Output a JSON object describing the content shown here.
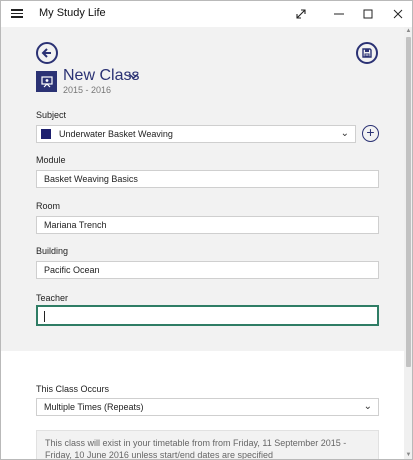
{
  "window": {
    "title": "My Study Life",
    "controls": [
      "resize-icon",
      "minimize-icon",
      "maximize-icon",
      "close-icon"
    ]
  },
  "header": {
    "title": "New Class",
    "year": "2015 - 2016",
    "accent": "#2b3274"
  },
  "form": {
    "subject": {
      "label": "Subject",
      "value": "Underwater Basket Weaving",
      "swatch_color": "#1d1f6e"
    },
    "module": {
      "label": "Module",
      "value": "Basket Weaving Basics"
    },
    "room": {
      "label": "Room",
      "value": "Mariana Trench"
    },
    "building": {
      "label": "Building",
      "value": "Pacific Ocean"
    },
    "teacher": {
      "label": "Teacher",
      "value": ""
    }
  },
  "occurs": {
    "label": "This Class Occurs",
    "value": "Multiple Times (Repeats)",
    "info": "This class will exist in your timetable from from Friday, 11 September 2015 - Friday, 10 June 2016 unless start/end dates are specified"
  },
  "colors": {
    "focus": "#2f7d65",
    "panel": "#ffffff",
    "background": "#f2f2f2"
  }
}
